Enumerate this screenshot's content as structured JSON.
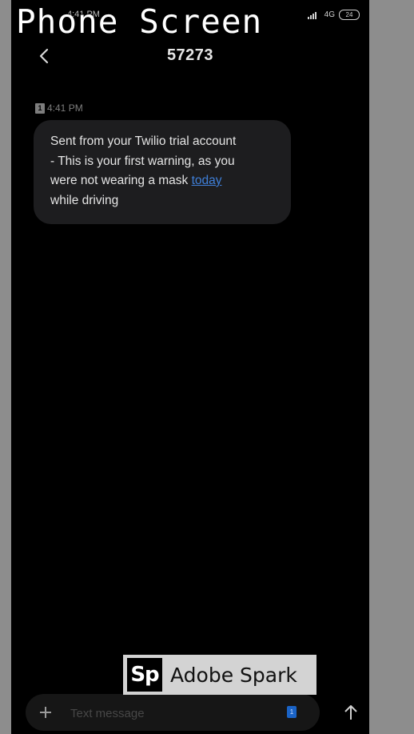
{
  "overlay": {
    "title": "Phone Screen"
  },
  "status_bar": {
    "time": "4:41 PM",
    "network": "4G",
    "battery": "24",
    "icons": [
      "signal-icon",
      "battery-icon"
    ]
  },
  "header": {
    "back_icon": "chevron-left-icon",
    "title": "57273"
  },
  "message": {
    "sim_label": "1",
    "timestamp": "4:41 PM",
    "lines": [
      "Sent from your Twilio trial account",
      "- This is your first warning, as you",
      "were not wearing a mask "
    ],
    "link_text": "today",
    "last_line": "while driving"
  },
  "watermark": {
    "logo_text": "Sp",
    "brand_text": "Adobe Spark"
  },
  "composer": {
    "placeholder": "Text message",
    "sim_label": "1",
    "add_icon": "plus-icon",
    "send_icon": "arrow-up-icon"
  },
  "colors": {
    "background": "#000000",
    "bubble": "#1d1d1f",
    "link": "#3f7fd8",
    "sim_badge": "#1a63c6"
  }
}
